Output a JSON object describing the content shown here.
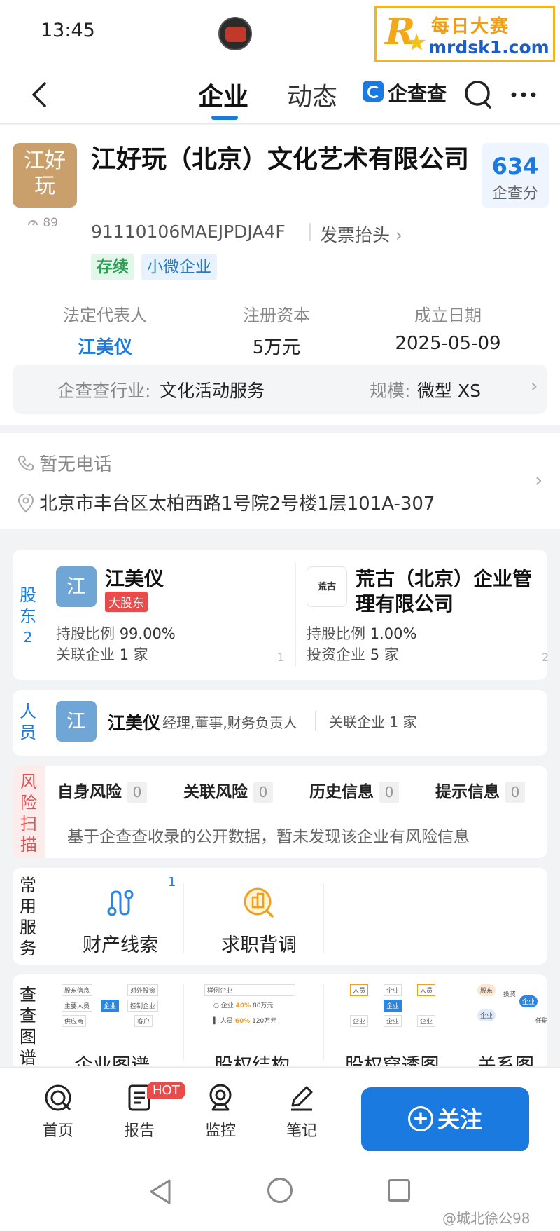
{
  "status_bar": {
    "time": "13:45"
  },
  "watermark": {
    "logo_letter": "R",
    "title": "每日大赛",
    "url": "mrdsk1.com"
  },
  "nav": {
    "tabs": [
      "企业",
      "动态"
    ],
    "brand": "企查查"
  },
  "company": {
    "logo_text": "江好玩",
    "heat": "89",
    "name": "江好玩（北京）文化艺术有限公司",
    "score": "634",
    "score_label": "企查分",
    "credit_code": "91110106MAEJPDJA4F",
    "invoice_label": "发票抬头",
    "tags": [
      "存续",
      "小微企业"
    ],
    "facts": [
      {
        "label": "法定代表人",
        "value": "江美仪"
      },
      {
        "label": "注册资本",
        "value": "5万元"
      },
      {
        "label": "成立日期",
        "value": "2025-05-09"
      }
    ],
    "industry_label": "企查查行业:",
    "industry_value": "文化活动服务",
    "scale_label": "规模:",
    "scale_value": "微型 XS"
  },
  "contact": {
    "phone": "暂无电话",
    "address": "北京市丰台区太柏西路1号院2号楼1层101A-307"
  },
  "shareholders": {
    "side_label": "股东",
    "count": "2",
    "items": [
      {
        "avatar": "江",
        "name": "江美仪",
        "badge": "大股东",
        "ratio_label": "持股比例",
        "ratio": "99.00%",
        "rel_label": "关联企业",
        "rel_count": "1",
        "rel_unit": "家",
        "index": "1"
      },
      {
        "avatar": "荒古",
        "name": "荒古（北京）企业管理有限公司",
        "badge": "",
        "ratio_label": "持股比例",
        "ratio": "1.00%",
        "rel_label": "投资企业",
        "rel_count": "5",
        "rel_unit": "家",
        "index": "2"
      }
    ]
  },
  "people": {
    "side_label": "人员",
    "avatar": "江",
    "name": "江美仪",
    "role": "经理,董事,财务负责人",
    "related": "关联企业 1 家"
  },
  "risk": {
    "side_label": "风险扫描",
    "items": [
      {
        "label": "自身风险",
        "count": "0"
      },
      {
        "label": "关联风险",
        "count": "0"
      },
      {
        "label": "历史信息",
        "count": "0"
      },
      {
        "label": "提示信息",
        "count": "0"
      }
    ],
    "note": "基于企查查收录的公开数据，暂未发现该企业有风险信息"
  },
  "services": {
    "side_label": "常用服务",
    "badge": "1",
    "items": [
      {
        "label": "财产线索",
        "icon": "route-icon"
      },
      {
        "label": "求职背调",
        "icon": "building-search-icon"
      }
    ]
  },
  "graphs": {
    "side_label": "查查图谱",
    "items": [
      {
        "label": "企业图谱",
        "thumb": [
          "股东信息",
          "对外投资",
          "主要人员",
          "企业",
          "控制企业",
          "供应商",
          "客户"
        ]
      },
      {
        "label": "股权结构",
        "thumb": [
          "样例企业",
          "企业",
          "40%",
          "80万元",
          "人员",
          "60%",
          "120万元"
        ]
      },
      {
        "label": "股权穿透图",
        "thumb": [
          "人员",
          "企业",
          "人员",
          "企业",
          "企业",
          "企业",
          "企业"
        ]
      },
      {
        "label": "关系图",
        "thumb": [
          "股东",
          "投资",
          "企业",
          "企业",
          "任职"
        ]
      }
    ]
  },
  "bottom_nav": {
    "items": [
      {
        "label": "首页",
        "icon": "home-q-icon"
      },
      {
        "label": "报告",
        "icon": "report-icon"
      },
      {
        "label": "监控",
        "icon": "monitor-icon"
      },
      {
        "label": "笔记",
        "icon": "pen-icon"
      }
    ],
    "hot_badge": "HOT",
    "follow_label": "关注"
  },
  "credit_watermark": "@城北徐公98"
}
